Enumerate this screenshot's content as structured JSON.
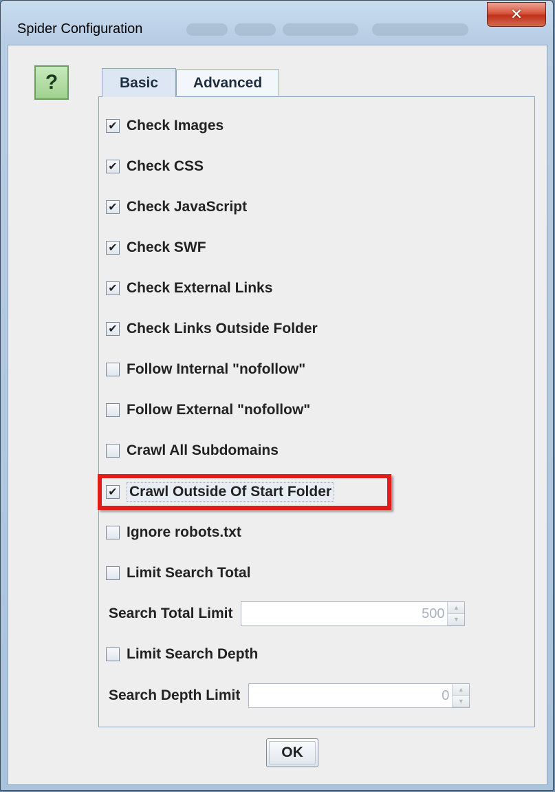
{
  "window": {
    "title": "Spider Configuration",
    "close_glyph": "✕"
  },
  "help": {
    "glyph": "?",
    "icon": "help-icon"
  },
  "tabs": [
    {
      "label": "Basic",
      "selected": true
    },
    {
      "label": "Advanced",
      "selected": false
    }
  ],
  "options": [
    {
      "label": "Check Images",
      "checked": true
    },
    {
      "label": "Check CSS",
      "checked": true
    },
    {
      "label": "Check JavaScript",
      "checked": true
    },
    {
      "label": "Check SWF",
      "checked": true
    },
    {
      "label": "Check External Links",
      "checked": true
    },
    {
      "label": "Check Links Outside Folder",
      "checked": true
    },
    {
      "label": "Follow Internal \"nofollow\"",
      "checked": false
    },
    {
      "label": "Follow External \"nofollow\"",
      "checked": false
    },
    {
      "label": "Crawl All Subdomains",
      "checked": false
    },
    {
      "label": "Crawl Outside Of Start Folder",
      "checked": true,
      "highlighted": true
    },
    {
      "label": "Ignore robots.txt",
      "checked": false
    },
    {
      "label": "Limit Search Total",
      "checked": false
    }
  ],
  "search_total": {
    "label": "Search Total Limit",
    "value": "500"
  },
  "limit_depth": {
    "label": "Limit Search Depth",
    "checked": false
  },
  "search_depth": {
    "label": "Search Depth Limit",
    "value": "0"
  },
  "check_glyph": "✔",
  "spin_up": "▲",
  "spin_down": "▼",
  "ok_label": "OK",
  "colors": {
    "highlight": "#e21b1b",
    "help_green": "#9fd28f",
    "close_red": "#c0311b"
  }
}
